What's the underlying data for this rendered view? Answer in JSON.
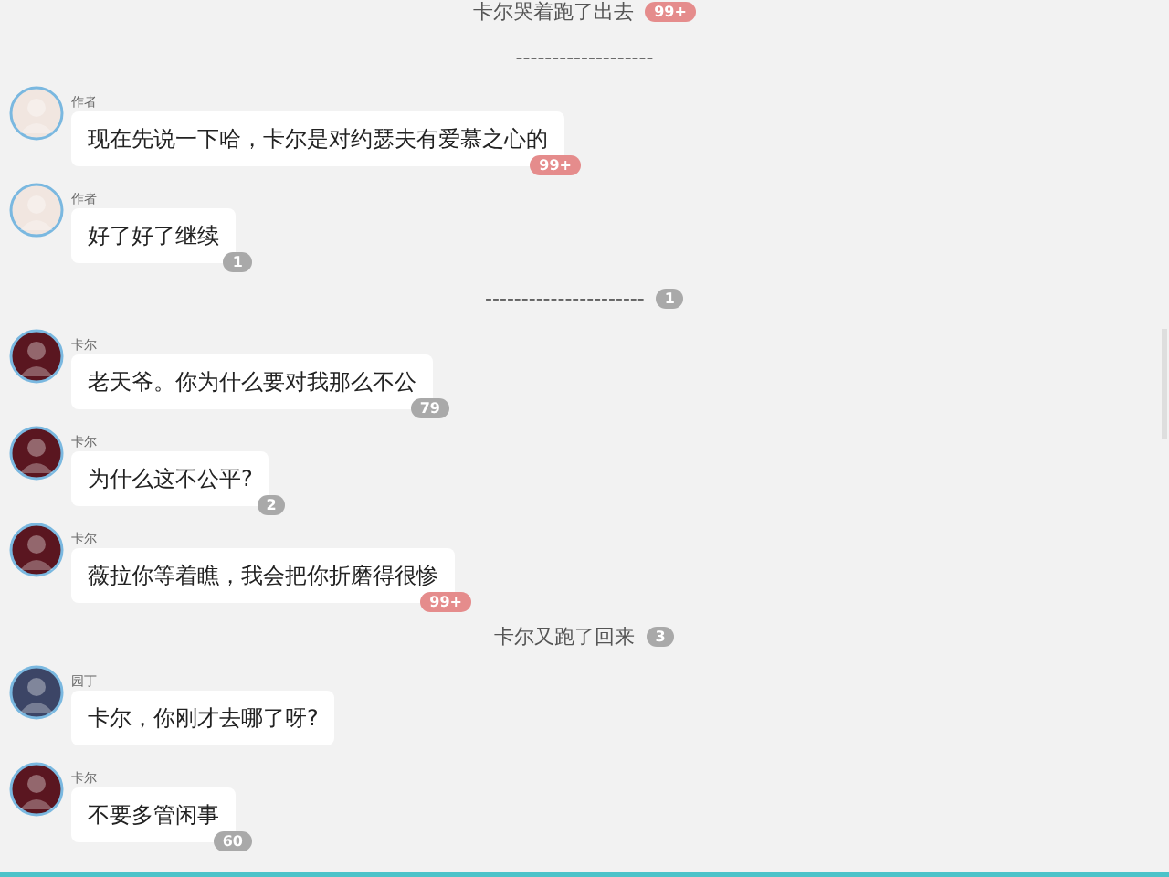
{
  "items": [
    {
      "kind": "narration",
      "text": "卡尔哭着跑了出去",
      "badge": "99+",
      "color": "#e58c8c"
    },
    {
      "kind": "narration",
      "text": "-------------------"
    },
    {
      "kind": "message",
      "name": "作者",
      "avatar": {
        "color": "#f1e6e0"
      },
      "text": "现在先说一下哈，卡尔是对约瑟夫有爱慕之心的",
      "badge": "99+",
      "color": "#e58c8c"
    },
    {
      "kind": "message",
      "name": "作者",
      "avatar": {
        "color": "#f1e6e0"
      },
      "text": "好了好了继续",
      "badge": "1",
      "color": "#a9a9a9"
    },
    {
      "kind": "narration",
      "text": "----------------------",
      "badge": "1",
      "color": "#a9a9a9"
    },
    {
      "kind": "message",
      "name": "卡尔",
      "avatar": {
        "color": "#5a1620"
      },
      "text": "老天爷。你为什么要对我那么不公",
      "badge": "79",
      "color": "#a9a9a9"
    },
    {
      "kind": "message",
      "name": "卡尔",
      "avatar": {
        "color": "#5a1620"
      },
      "text": "为什么这不公平?",
      "badge": "2",
      "color": "#a9a9a9"
    },
    {
      "kind": "message",
      "name": "卡尔",
      "avatar": {
        "color": "#5a1620"
      },
      "text": "薇拉你等着瞧，我会把你折磨得很惨",
      "badge": "99+",
      "color": "#e58c8c"
    },
    {
      "kind": "narration",
      "text": "卡尔又跑了回来",
      "badge": "3",
      "color": "#a9a9a9"
    },
    {
      "kind": "message",
      "name": "园丁",
      "avatar": {
        "color": "#3c4566"
      },
      "text": "卡尔，你刚才去哪了呀?"
    },
    {
      "kind": "message",
      "name": "卡尔",
      "avatar": {
        "color": "#5a1620"
      },
      "text": "不要多管闲事",
      "badge": "60",
      "color": "#a9a9a9"
    }
  ]
}
